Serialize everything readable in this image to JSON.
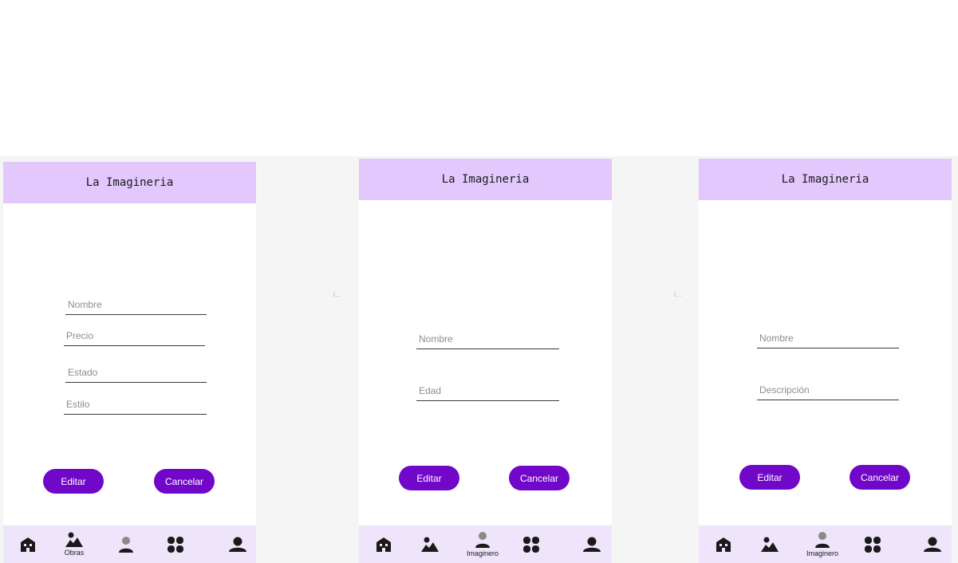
{
  "app": {
    "title": "La Imagineria"
  },
  "screens": [
    {
      "id": "obras-edit",
      "fields": [
        {
          "label": "Nombre"
        },
        {
          "label": "Precio"
        },
        {
          "label": "Estado"
        },
        {
          "label": "Estilo"
        }
      ],
      "buttons": {
        "primary": "Editar",
        "secondary": "Cancelar"
      },
      "nav": {
        "active_label": "Obras",
        "items": [
          "home-icon",
          "obras-icon",
          "person-icon",
          "grid-icon",
          "profile-icon"
        ]
      }
    },
    {
      "id": "imaginero-edit-edad",
      "fields": [
        {
          "label": "Nombre"
        },
        {
          "label": "Edad"
        }
      ],
      "buttons": {
        "primary": "Editar",
        "secondary": "Cancelar"
      },
      "nav": {
        "active_label": "Imaginero",
        "items": [
          "home-icon",
          "obras-icon",
          "person-icon",
          "grid-icon",
          "profile-icon"
        ]
      }
    },
    {
      "id": "imaginero-edit-descripcion",
      "fields": [
        {
          "label": "Nombre"
        },
        {
          "label": "Descripción"
        }
      ],
      "buttons": {
        "primary": "Editar",
        "secondary": "Cancelar"
      },
      "nav": {
        "active_label": "Imaginero",
        "items": [
          "home-icon",
          "obras-icon",
          "person-icon",
          "grid-icon",
          "profile-icon"
        ]
      }
    }
  ],
  "canvas": {
    "ellipsis_marker": "i..."
  },
  "colors": {
    "header_bg": "#e2c8fc",
    "nav_bg": "#efe5fb",
    "button_bg": "#7107c8",
    "canvas_bg": "#f5f5f5"
  }
}
